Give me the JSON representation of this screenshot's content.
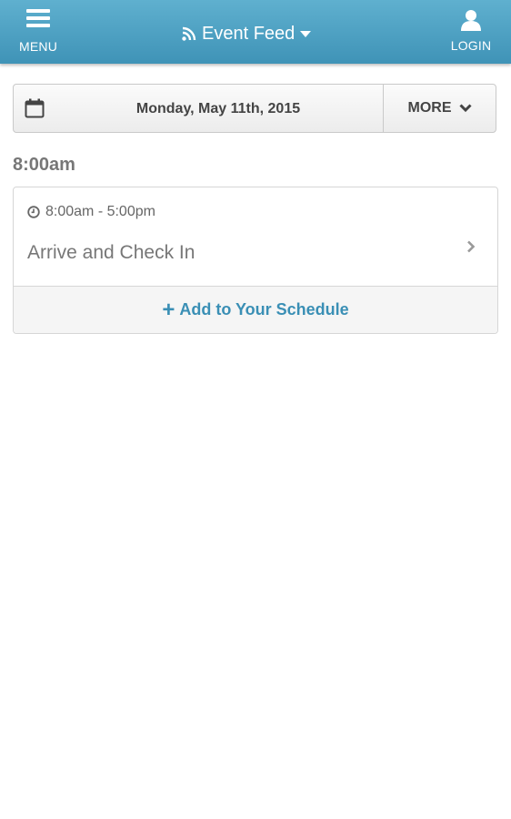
{
  "header": {
    "menu_label": "MENU",
    "feed_title": "Event Feed",
    "login_label": "LOGIN"
  },
  "datebar": {
    "date": "Monday, May 11th, 2015",
    "more_label": "MORE"
  },
  "schedule": {
    "time_heading": "8:00am",
    "session": {
      "time_range": "8:00am - 5:00pm",
      "title": "Arrive and Check In",
      "add_label": "Add to Your Schedule"
    }
  },
  "colors": {
    "header_gradient_top": "#5fb0cf",
    "header_gradient_bottom": "#3f93b7",
    "accent": "#3a8fb5"
  },
  "icons": [
    "hamburger-icon",
    "rss-icon",
    "caret-down-icon",
    "user-icon",
    "calendar-icon",
    "chevron-down-icon",
    "clock-icon",
    "chevron-right-icon",
    "plus-icon"
  ]
}
